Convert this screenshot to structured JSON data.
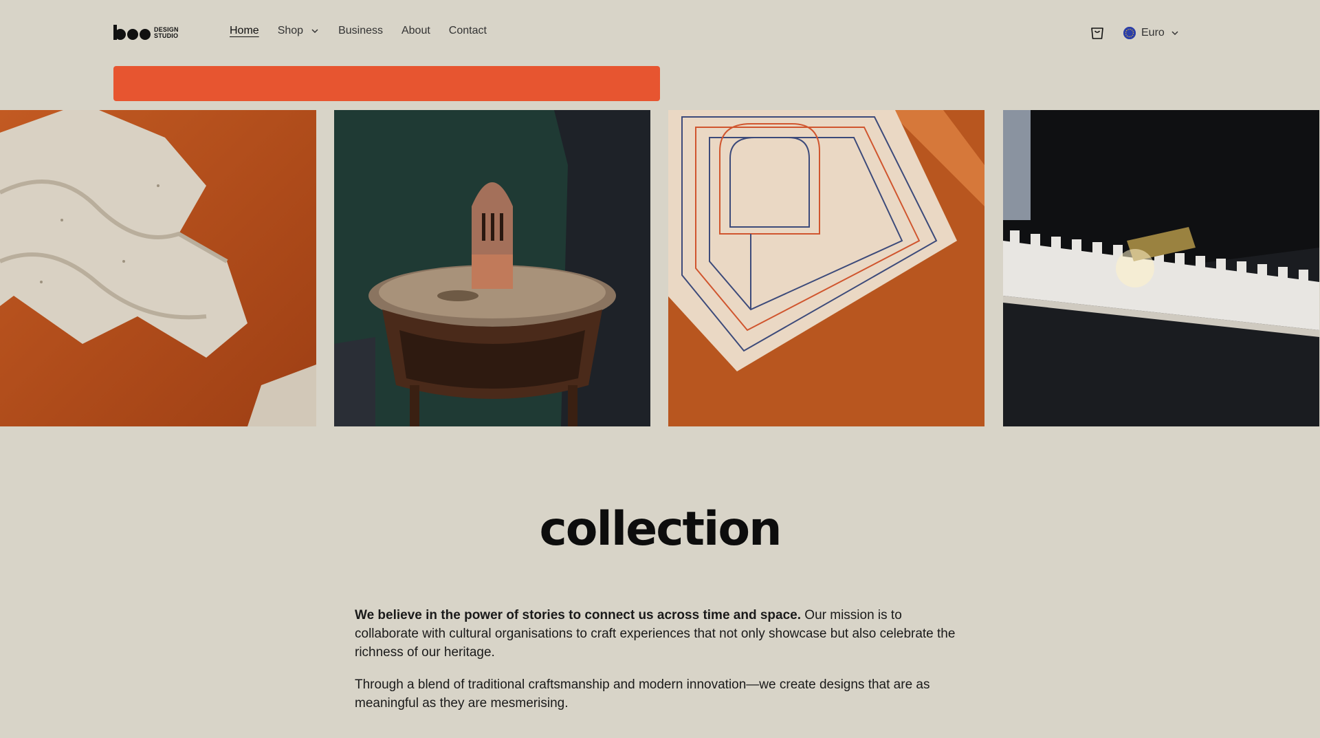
{
  "brand": {
    "logo_word": "boo",
    "logo_line1": "DESIGN",
    "logo_line2": "STUDIO"
  },
  "nav": {
    "items": [
      {
        "label": "Home",
        "active": true
      },
      {
        "label": "Shop",
        "has_dropdown": true
      },
      {
        "label": "Business"
      },
      {
        "label": "About"
      },
      {
        "label": "Contact"
      }
    ]
  },
  "header": {
    "cart_icon": "cart-icon",
    "currency": "Euro",
    "flag_icon": "eu-flag-icon"
  },
  "colors": {
    "background": "#d8d4c8",
    "banner": "#e75530",
    "text": "#111111"
  },
  "gallery": {
    "tiles": [
      {
        "name": "travertine-tray-image"
      },
      {
        "name": "incense-burner-image"
      },
      {
        "name": "embroidered-rug-image"
      },
      {
        "name": "advent-calendar-image"
      }
    ]
  },
  "collection": {
    "title": "collection",
    "intro_bold": "We believe in the power of stories to connect us across time and space.",
    "intro_rest": " Our mission is to collaborate with cultural organisations to craft experiences that not only showcase but also celebrate the richness of our heritage.",
    "paragraph2": "Through a blend of traditional craftsmanship and modern innovation—we create designs that are as meaningful as they are mesmerising."
  }
}
